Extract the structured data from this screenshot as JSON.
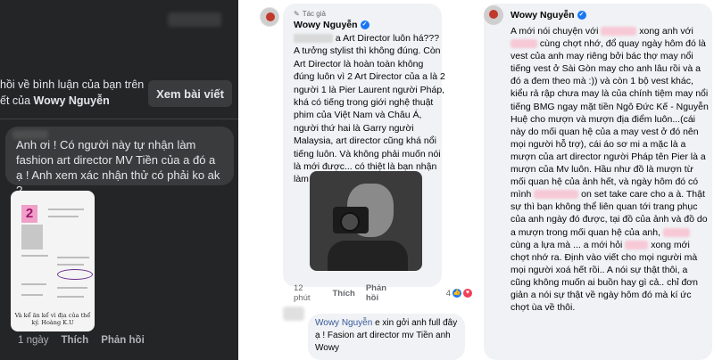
{
  "panel1": {
    "notice_line1": "hồi về bình luận của bạn trên",
    "notice_line2_prefix": "ết của ",
    "notice_name": "Wowy Nguyễn",
    "view_button": "Xem bài viết",
    "message": "Anh ơi ! Có người này tự nhận làm fashion art director MV Tiền của a đó a ạ ! Anh xem xác nhận thử có phải ko ak ?",
    "thumbnail_badge": "2",
    "thumbnail_caption": "Và kể ăn kể vì địa của thể ký. Hoàng K.U",
    "time": "1 ngày",
    "like": "Thích",
    "reply": "Phản hồi"
  },
  "panel2": {
    "author_tag": "Tác giả",
    "author_name": "Wowy Nguyễn",
    "comment_pre": "",
    "comment_body": "a Art Director luôn há??? A tưởng stylist thì không đúng. Còn Art Director là hoàn toàn không đúng luôn vì 2 Art Director của a là 2 người 1 là Pier Laurent người Pháp, khá có tiếng trong giới nghệ thuật phim của Việt Nam và Châu Á, người thứ hai là Garry người Malaysia, art director cũng khá nổi tiếng luôn. Và không phải muốn nói là mới được... có thiệt là bạn nhận làm art director không vậy ...",
    "time": "12 phút",
    "like": "Thích",
    "reply": "Phản hồi",
    "reaction_count": "4",
    "reply_name": "Wowy Nguyễn",
    "reply_text": " e xin gởi anh full đây ạ ! Fasion art director mv Tiền anh Wowy"
  },
  "panel3": {
    "author_name": "Wowy Nguyễn",
    "seg1": "A mới nói chuyện với ",
    "seg2": " xong anh với ",
    "seg3": " cùng chợt nhớ, đổ quay ngày hôm đó là vest của anh may riêng bởi bác thợ may nổi tiếng vest ở Sài Gòn may cho anh lâu rồi và a đó a đem theo mà :)) và còn 1 bộ vest khác, kiểu rả rập chưa may là của chính tiệm may nổi tiếng BMG ngay mặt tiền Ngô Đức Kế - Nguyễn Huệ cho mượn và mượn địa điểm luôn...(cái này do mối quan hệ của a may vest ở đó nên mọi người hỗ trợ), cái áo sơ mi a mặc là a mượn của art director người Pháp tên Pier là a mượn của Mv luôn. Hầu như đồ là mượn từ mối quan hệ của ảnh hết, và ngày hôm đó có mình ",
    "seg4": " on set take care cho a à. Thật sự thì bạn không thể liên quan tới trang phục của anh ngày đó được, tại đồ của ảnh và đồ do a mượn trong mối quan hệ của anh, ",
    "seg5": " cùng a lựa mà ... a mới hỏi ",
    "seg6": " xong mới chợt nhớ ra. Định vào viết cho mọi người mà mọi người xoá hết rồi.. A nói sự thật thôi, a cũng không muốn ai buồn hay gì cả.. chỉ đơn giản a nói sự thật về ngày hôm đó mà kí ức chợt ùa về thôi."
  },
  "colors": {
    "dark_bg": "#242526",
    "bubble_light": "#f0f2f5",
    "verified": "#1877f2",
    "redaction": "#f7c9d6"
  }
}
